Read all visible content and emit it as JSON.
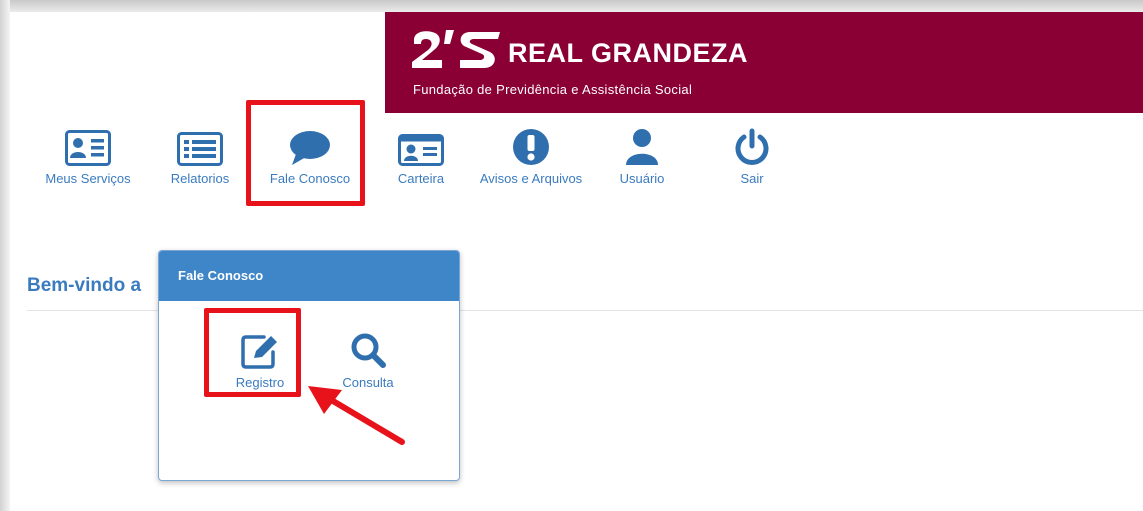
{
  "brand": {
    "name": "REAL GRANDEZA",
    "subtitle": "Fundação de Previdência e Assistência Social",
    "color": "#8a0034"
  },
  "nav": {
    "items": [
      {
        "label": "Meus Serviços",
        "icon": "id-card-icon"
      },
      {
        "label": "Relatorios",
        "icon": "list-icon"
      },
      {
        "label": "Fale Conosco",
        "icon": "chat-bubble-icon"
      },
      {
        "label": "Carteira",
        "icon": "card-icon"
      },
      {
        "label": "Avisos e Arquivos",
        "icon": "exclamation-icon"
      },
      {
        "label": "Usuário",
        "icon": "user-icon"
      },
      {
        "label": "Sair",
        "icon": "power-icon"
      }
    ]
  },
  "main": {
    "welcome": "Bem-vindo a"
  },
  "popup": {
    "title": "Fale Conosco",
    "items": [
      {
        "label": "Registro",
        "icon": "edit-icon"
      },
      {
        "label": "Consulta",
        "icon": "search-icon"
      }
    ]
  },
  "colors": {
    "accent": "#3a7bbf",
    "popup_header": "#3f86c8",
    "highlight": "#e8121b"
  }
}
